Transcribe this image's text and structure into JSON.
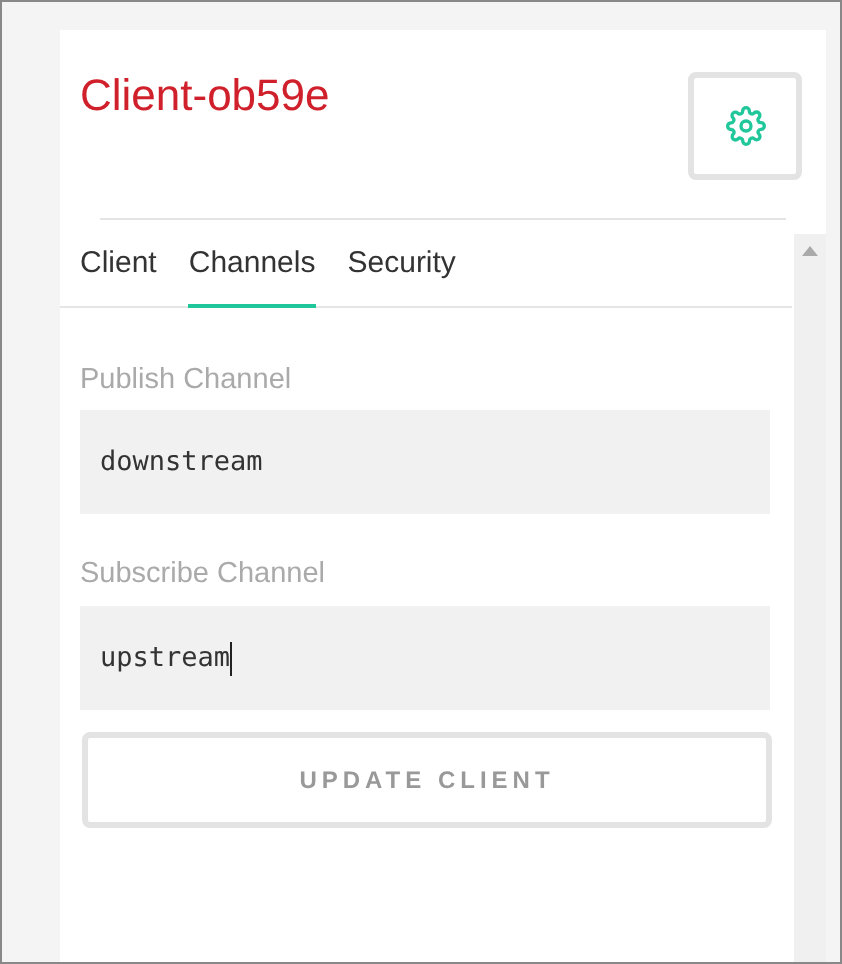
{
  "title": "Client-ob59e",
  "tabs": [
    {
      "label": "Client",
      "selected": false
    },
    {
      "label": "Channels",
      "selected": true
    },
    {
      "label": "Security",
      "selected": false
    }
  ],
  "fields": [
    {
      "label": "Publish Channel",
      "value": "downstream",
      "focused": false
    },
    {
      "label": "Subscribe Channel",
      "value": "upstream",
      "focused": true
    }
  ],
  "button": "UPDATE CLIENT"
}
